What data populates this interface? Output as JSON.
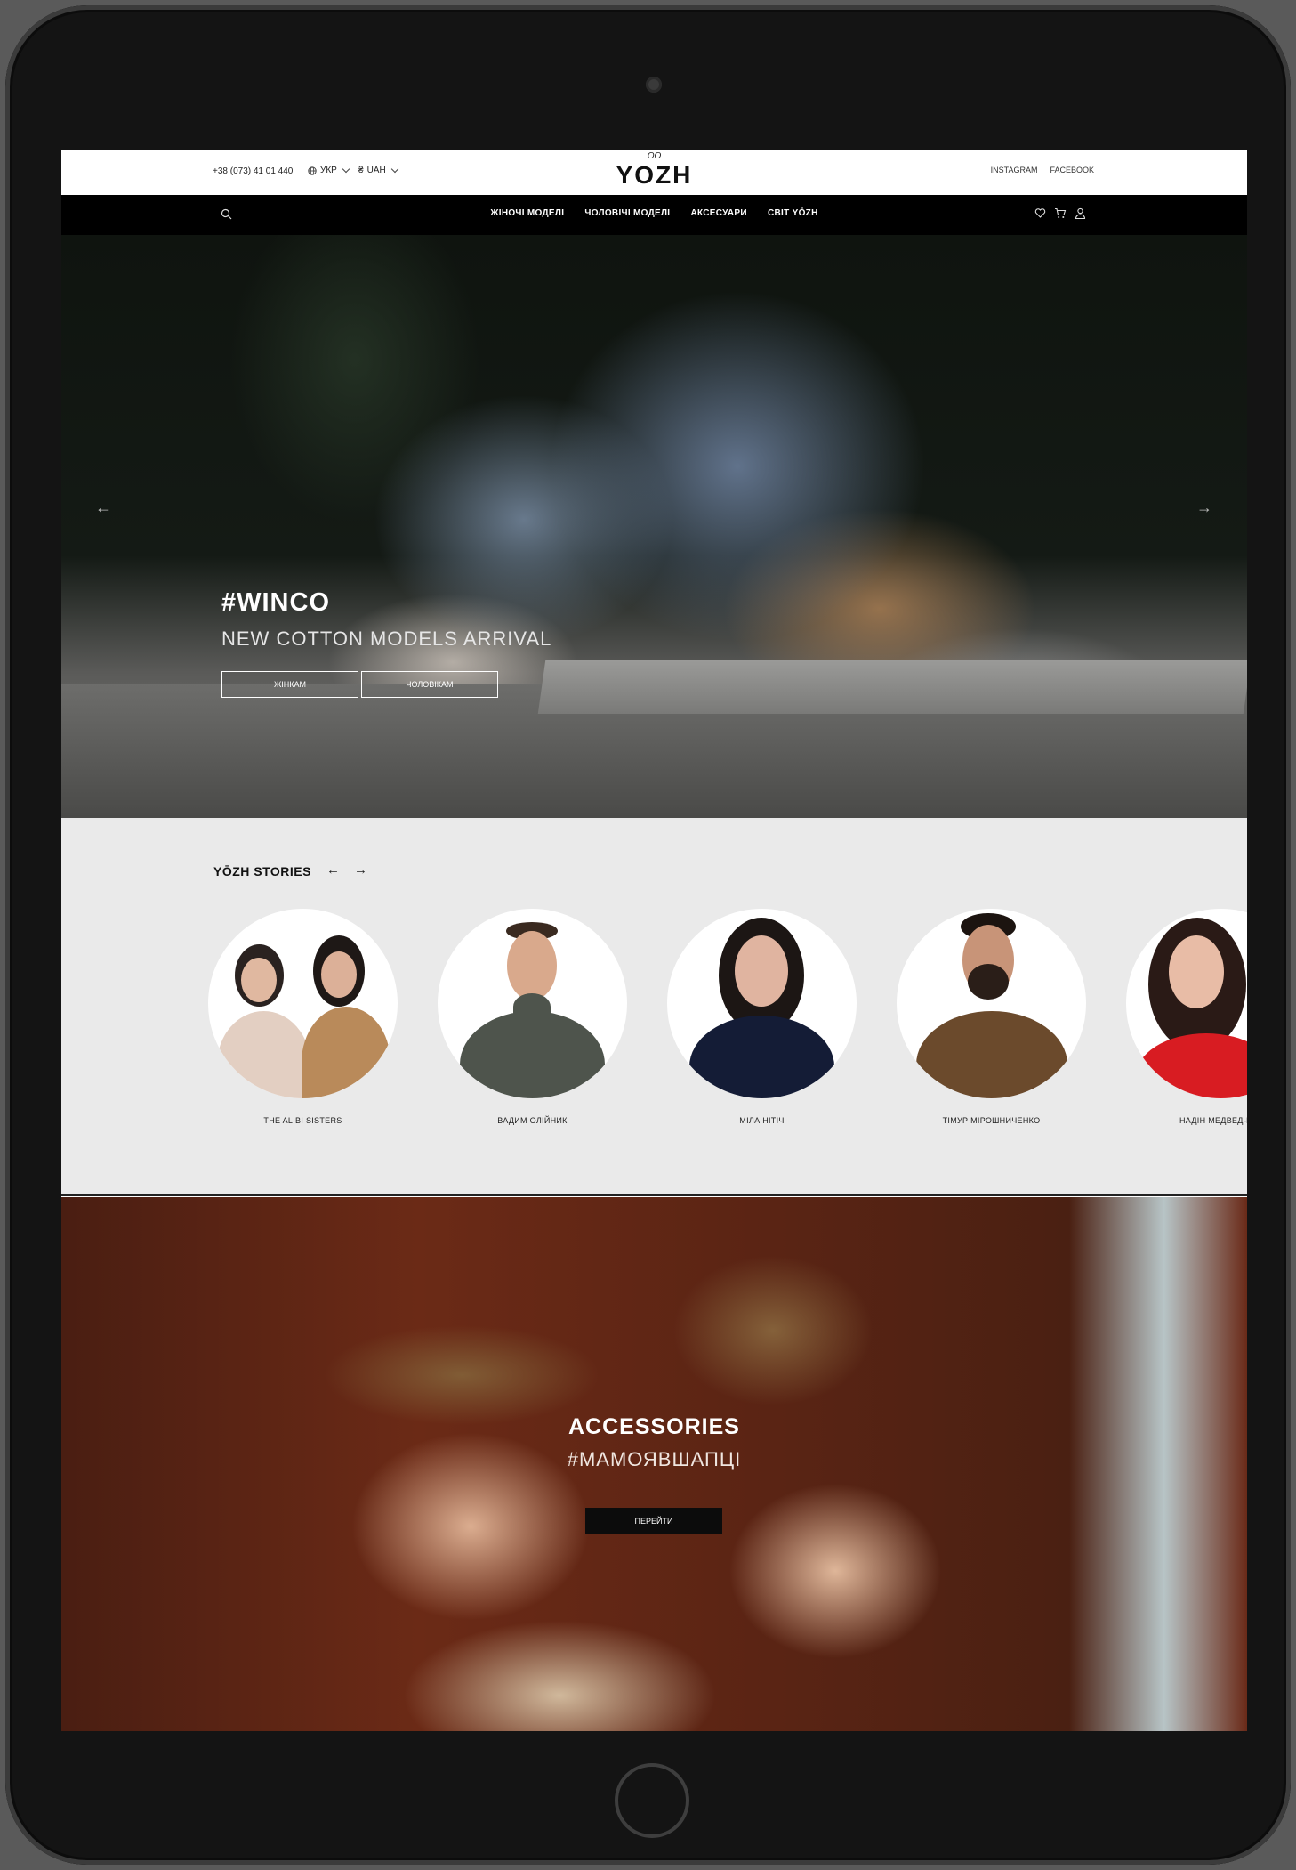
{
  "topbar": {
    "phone": "+38 (073) 41 01 440",
    "language": "УКР",
    "currency_symbol": "₴",
    "currency": "UAH",
    "logo_mark": "ОО",
    "logo_text": "YOZH",
    "instagram": "INSTAGRAM",
    "facebook": "FACEBOOK"
  },
  "nav": {
    "items": [
      "ЖІНОЧІ МОДЕЛІ",
      "ЧОЛОВІЧІ МОДЕЛІ",
      "АКСЕСУАРИ",
      "СВІТ YŌZH"
    ],
    "icons": [
      "search-icon",
      "heart-icon",
      "cart-icon",
      "user-icon"
    ]
  },
  "hero": {
    "title": "#WINCO",
    "subtitle": "NEW COTTON MODELS ARRIVAL",
    "women_button": "ЖІНКАМ",
    "men_button": "ЧОЛОВІКАМ",
    "prev_arrow": "←",
    "next_arrow": "→"
  },
  "stories": {
    "heading": "YŌZH STORIES",
    "prev_arrow": "←",
    "next_arrow": "→",
    "items": [
      {
        "name": "THE ALIBI SISTERS"
      },
      {
        "name": "ВАДИМ ОЛІЙНИК"
      },
      {
        "name": "МІЛА НІТІЧ"
      },
      {
        "name": "ТІМУР МІРОШНИЧЕНКО"
      },
      {
        "name": "НАДІН МЕДВЕДЧ"
      }
    ]
  },
  "accessories": {
    "title": "ACCESSORIES",
    "hashtag": "#МАМОЯВШАПЦІ",
    "button": "ПЕРЕЙТИ"
  },
  "colors": {
    "nav_bg": "#000000",
    "stories_bg": "#eaeaea",
    "button_dark": "#0c0c0c"
  }
}
